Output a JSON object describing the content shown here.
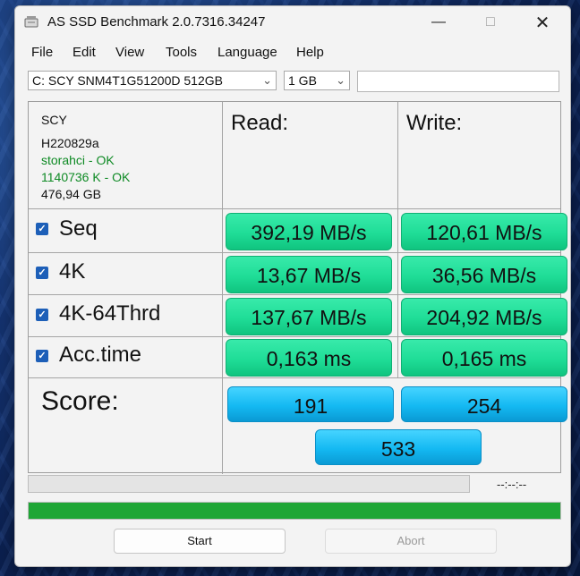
{
  "window": {
    "title": "AS SSD Benchmark 2.0.7316.34247"
  },
  "menu": [
    "File",
    "Edit",
    "View",
    "Tools",
    "Language",
    "Help"
  ],
  "toolbar": {
    "drive_select": "C: SCY SNM4T1G51200D 512GB",
    "size_select": "1 GB",
    "text_field": ""
  },
  "drive_info": {
    "vendor": "SCY",
    "firmware": "H220829a",
    "driver_status": "storahci - OK",
    "alignment_status": "1140736 K - OK",
    "capacity": "476,94 GB"
  },
  "columns": {
    "read": "Read:",
    "write": "Write:"
  },
  "rows": [
    {
      "label": "Seq",
      "checked": true,
      "read": "392,19 MB/s",
      "write": "120,61 MB/s"
    },
    {
      "label": "4K",
      "checked": true,
      "read": "13,67 MB/s",
      "write": "36,56 MB/s"
    },
    {
      "label": "4K-64Thrd",
      "checked": true,
      "read": "137,67 MB/s",
      "write": "204,92 MB/s"
    },
    {
      "label": "Acc.time",
      "checked": true,
      "read": "0,163 ms",
      "write": "0,165 ms"
    }
  ],
  "score": {
    "label": "Score:",
    "read": "191",
    "write": "254",
    "total": "533"
  },
  "progress": {
    "elapsed": "--:--:--",
    "overall_fraction": 1.0
  },
  "buttons": {
    "start": "Start",
    "abort": "Abort"
  },
  "colors": {
    "value_green": "#1fdd97",
    "score_blue": "#14b9f2",
    "progress_green": "#1fa636",
    "ok_text": "#0e8a24"
  }
}
